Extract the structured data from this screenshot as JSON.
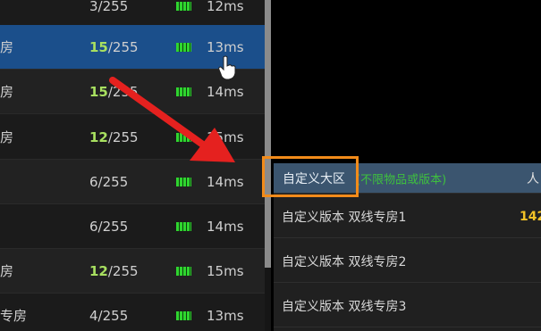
{
  "server_list": {
    "rows": [
      {
        "name": "",
        "current": "3",
        "max": "/255",
        "ping": "12ms",
        "highlight": false
      },
      {
        "name": "房",
        "current": "15",
        "max": "/255",
        "ping": "13ms",
        "highlight": true
      },
      {
        "name": "房",
        "current": "15",
        "max": "/255",
        "ping": "14ms",
        "highlight": true
      },
      {
        "name": "房",
        "current": "12",
        "max": "/255",
        "ping": "15ms",
        "highlight": true
      },
      {
        "name": "",
        "current": "6",
        "max": "/255",
        "ping": "14ms",
        "highlight": false
      },
      {
        "name": "",
        "current": "6",
        "max": "/255",
        "ping": "14ms",
        "highlight": false
      },
      {
        "name": "房",
        "current": "12",
        "max": "/255",
        "ping": "15ms",
        "highlight": true
      },
      {
        "name": "专房",
        "current": "4",
        "max": "/255",
        "ping": "13ms",
        "highlight": false
      }
    ]
  },
  "region_dropdown": {
    "header_label": "自定义大区",
    "header_note": "(不限物品或版本)",
    "header_trailing": "人",
    "items": [
      {
        "label": "自定义版本 双线专房1",
        "value": "142"
      },
      {
        "label": "自定义版本 双线专房2",
        "value": ""
      },
      {
        "label": "自定义版本 双线专房3",
        "value": ""
      }
    ]
  },
  "colors": {
    "selected_row": "#1b4f8b",
    "highlight_box": "#f28b1a",
    "arrow": "#e5211f",
    "player_count_accent": "#a8e060",
    "signal": "#2fd52f"
  }
}
